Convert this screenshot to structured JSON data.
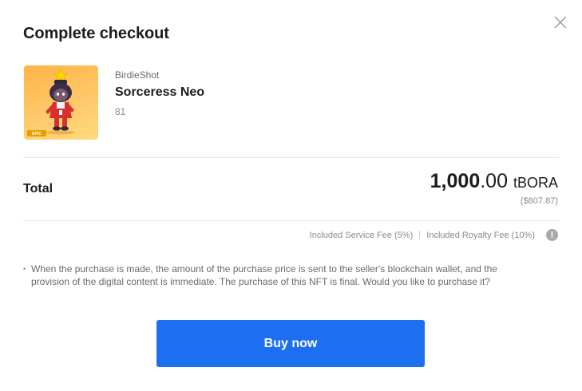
{
  "dialog": {
    "title": "Complete checkout",
    "close_icon": "close-icon"
  },
  "item": {
    "collection": "BirdieShot",
    "name": "Sorceress Neo",
    "token_id": "81",
    "badge": "EPIC"
  },
  "total": {
    "label": "Total",
    "amount_int": "1,000",
    "amount_dec": ".00",
    "currency": "tBORA",
    "usd": "($807.87)"
  },
  "fees": {
    "service_fee": "Included Service Fee (5%)",
    "royalty_fee": "Included Royalty Fee (10%)",
    "info_icon": "info-icon",
    "info_glyph": "!"
  },
  "notice": {
    "bullet": "•",
    "text": "When the purchase is made, the amount of the purchase price is sent to the seller's blockchain wallet, and the provision of the digital content is immediate. The purchase of this NFT is final. Would you like to purchase it?"
  },
  "actions": {
    "buy_label": "Buy now"
  },
  "colors": {
    "primary": "#1e6ff0",
    "thumb_bg": "#ffb347"
  }
}
